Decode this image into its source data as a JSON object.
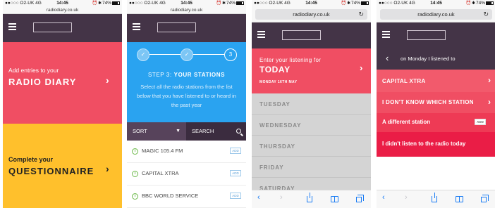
{
  "status": {
    "carrier": "●●○○○ O2-UK",
    "network": "4G",
    "time": "14:45",
    "battery": "74%"
  },
  "urls": {
    "p1": "radiodiary.co.uk",
    "p2": "radiodiary.co.uk",
    "p3": "radiodiary.co.uk",
    "p4": "radiodiary.co.uk"
  },
  "phone1": {
    "hero_small": "Add entries to your",
    "hero_big": "RADIO DIARY",
    "q_small": "Complete your",
    "q_big": "QUESTIONNAIRE"
  },
  "phone2": {
    "steps": [
      "✓",
      "✓",
      "3"
    ],
    "title_prefix": "STEP 3:",
    "title_main": "YOUR STATIONS",
    "description": "Select all the radio stations from the list below that you have listened to or heard in the past year",
    "sort_label": "SORT",
    "search_label": "SEARCH",
    "add_label": "ADD",
    "stations": [
      "MAGIC 105.4 FM",
      "CAPITAL XTRA",
      "BBC WORLD SERVICE"
    ]
  },
  "phone3": {
    "enter_text": "Enter your listening for",
    "today": "TODAY",
    "date": "MONDAY 16TH MAY",
    "days": [
      "TUESDAY",
      "WEDNESDAY",
      "THURSDAY",
      "FRIDAY",
      "SATURDAY"
    ]
  },
  "phone4": {
    "header": "on Monday I listened to",
    "add_label": "ADD",
    "rows": [
      "CAPITAL XTRA",
      "I DON'T KNOW WHICH STATION",
      "A different station",
      "I didn't listen to the radio today"
    ]
  },
  "colors": {
    "pink": "#f04e63",
    "yellow": "#ffc02c",
    "blue": "#2aa3f0",
    "aubergine": "#443447",
    "ios_blue": "#1a7cf4"
  },
  "icons": [
    "menu-icon",
    "chevron-right-icon",
    "check-icon",
    "info-icon",
    "search-icon",
    "chevron-down-icon",
    "reload-icon",
    "back-icon",
    "forward-icon",
    "share-icon",
    "bookmarks-icon",
    "tabs-icon",
    "chevron-left-icon"
  ]
}
